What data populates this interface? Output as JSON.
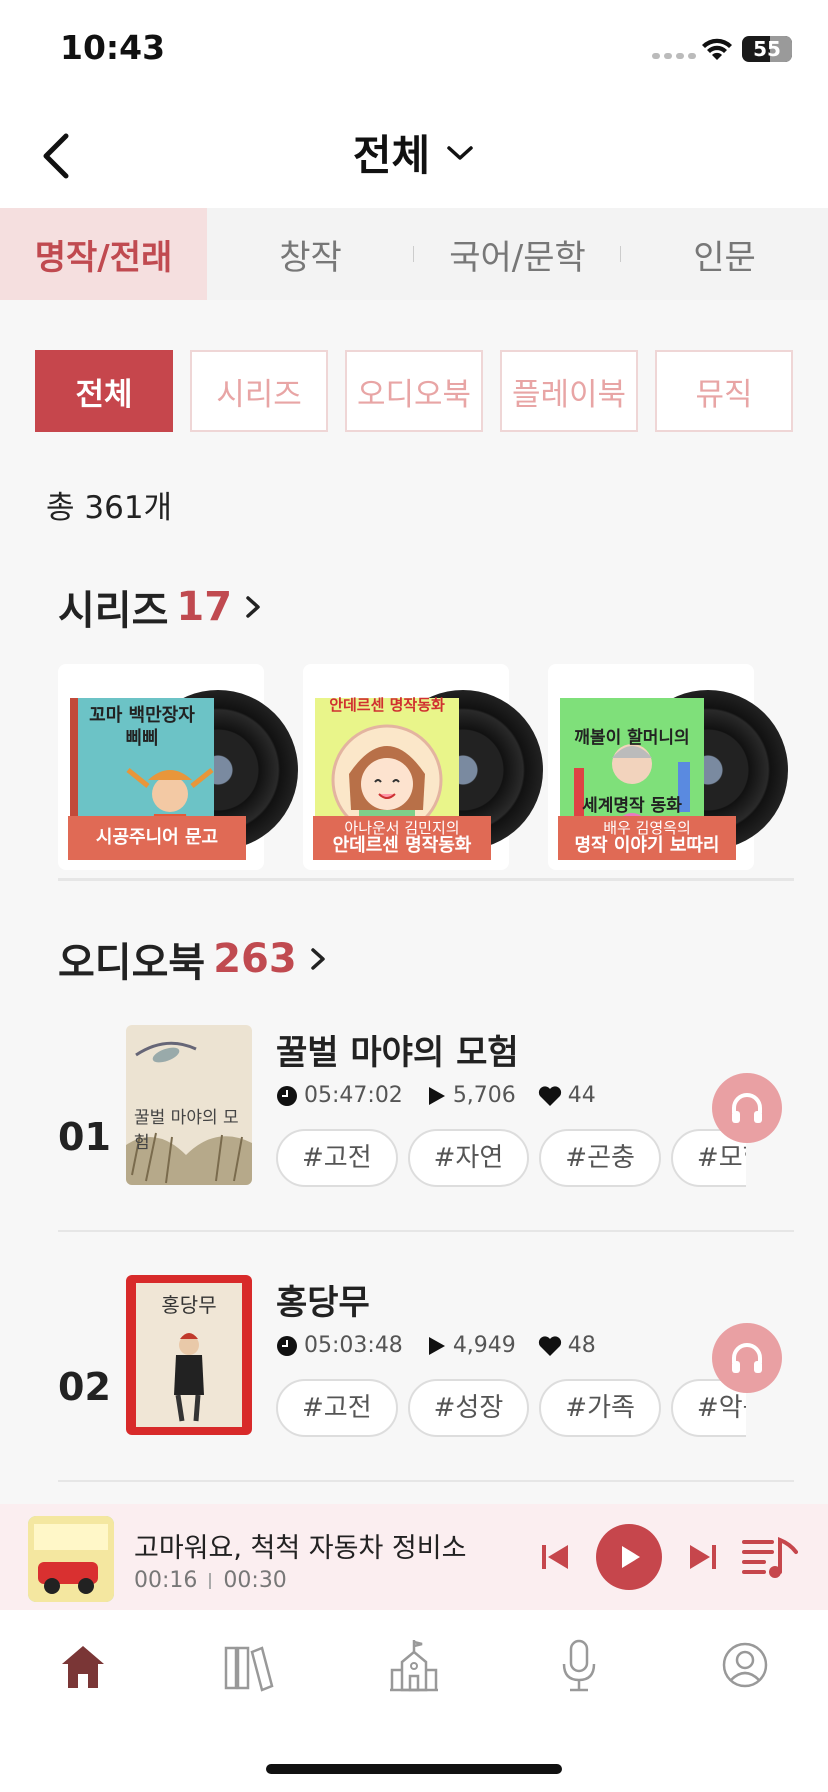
{
  "status": {
    "time": "10:43",
    "battery": "55"
  },
  "nav": {
    "title": "전체"
  },
  "category_tabs": [
    "명작/전래",
    "창작",
    "국어/문학",
    "인문"
  ],
  "filters": [
    "전체",
    "시리즈",
    "오디오북",
    "플레이북",
    "뮤직"
  ],
  "total": "총 361개",
  "series": {
    "label": "시리즈",
    "count": "17",
    "items": [
      {
        "cover_title": "꼬마 백만장자\n삐삐",
        "line1": "",
        "line2": "시공주니어 문고"
      },
      {
        "cover_title": "안데르센 명작동화",
        "line1": "아나운서 김민지의",
        "line2": "안데르센 명작동화"
      },
      {
        "cover_title": "깨볼이 할머니의\n세계명작 동화",
        "line1": "배우 김영옥의",
        "line2": "명작 이야기 보따리"
      }
    ]
  },
  "audiobook": {
    "label": "오디오북",
    "count": "263",
    "items": [
      {
        "num": "01",
        "title": "꿀벌 마야의 모험",
        "duration": "05:47:02",
        "plays": "5,706",
        "likes": "44",
        "tags": [
          "#고전",
          "#자연",
          "#곤충",
          "#모험"
        ],
        "cover_text": "꿀벌 마야의 모험"
      },
      {
        "num": "02",
        "title": "홍당무",
        "duration": "05:03:48",
        "plays": "4,949",
        "likes": "48",
        "tags": [
          "#고전",
          "#성장",
          "#가족",
          "#악동"
        ],
        "cover_text": "홍당무"
      }
    ]
  },
  "mini_player": {
    "title": "고마워요, 척척 자동차 정비소",
    "elapsed": "00:16",
    "total": "00:30"
  },
  "colors": {
    "accent": "#c6464c",
    "accent_light": "#f5dfdf"
  }
}
